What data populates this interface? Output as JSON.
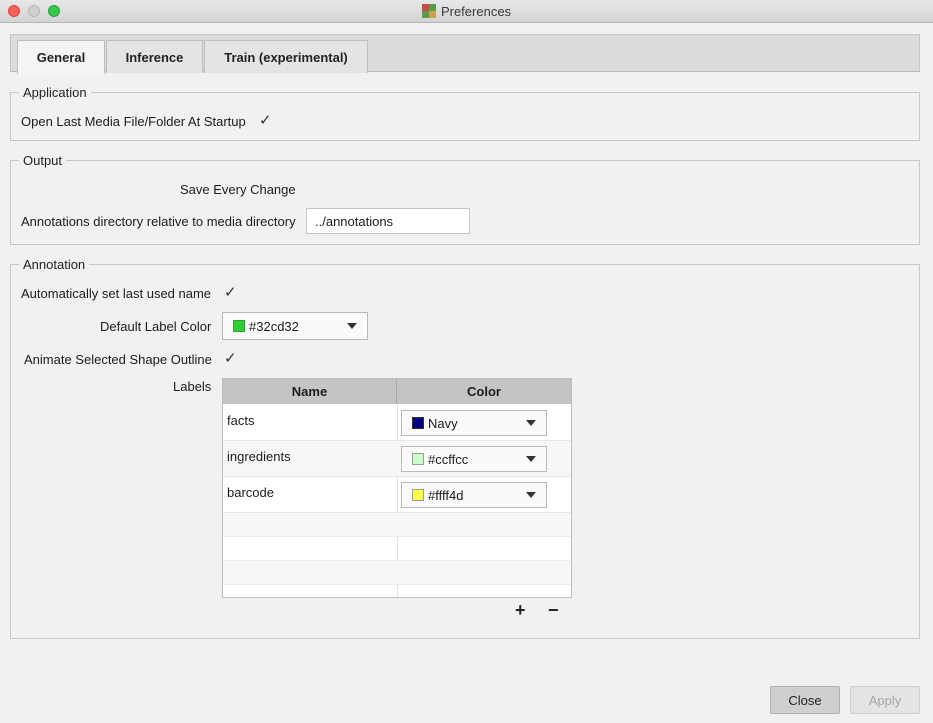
{
  "window": {
    "title": "Preferences"
  },
  "tabs": [
    {
      "label": "General",
      "active": true
    },
    {
      "label": "Inference",
      "active": false
    },
    {
      "label": "Train (experimental)",
      "active": false
    }
  ],
  "application": {
    "legend": "Application",
    "open_last_label": "Open Last Media File/Folder At Startup",
    "open_last_checked": "✓"
  },
  "output": {
    "legend": "Output",
    "save_every_change_label": "Save Every Change",
    "annotations_dir_label": "Annotations directory relative to media directory",
    "annotations_dir_value": "../annotations"
  },
  "annotation": {
    "legend": "Annotation",
    "auto_last_name_label": "Automatically set last used name",
    "auto_last_name_checked": "✓",
    "default_color_label": "Default Label Color",
    "default_color_value": "#32cd32",
    "default_color_swatch": "#32cd32",
    "animate_outline_label": "Animate Selected Shape Outline",
    "animate_outline_checked": "✓",
    "labels_label": "Labels",
    "table": {
      "headers": [
        "Name",
        "Color"
      ],
      "rows": [
        {
          "name": "facts",
          "color": "Navy",
          "swatch": "#000080"
        },
        {
          "name": "ingredients",
          "color": "#ccffcc",
          "swatch": "#ccffcc"
        },
        {
          "name": "barcode",
          "color": "#ffff4d",
          "swatch": "#ffff4d"
        }
      ]
    },
    "add_symbol": "+",
    "remove_symbol": "−"
  },
  "buttons": {
    "close": "Close",
    "apply": "Apply"
  },
  "icons": {
    "add": "plus-icon",
    "remove": "minus-icon",
    "dropdown": "chevron-down-icon",
    "check": "checkmark-icon"
  }
}
